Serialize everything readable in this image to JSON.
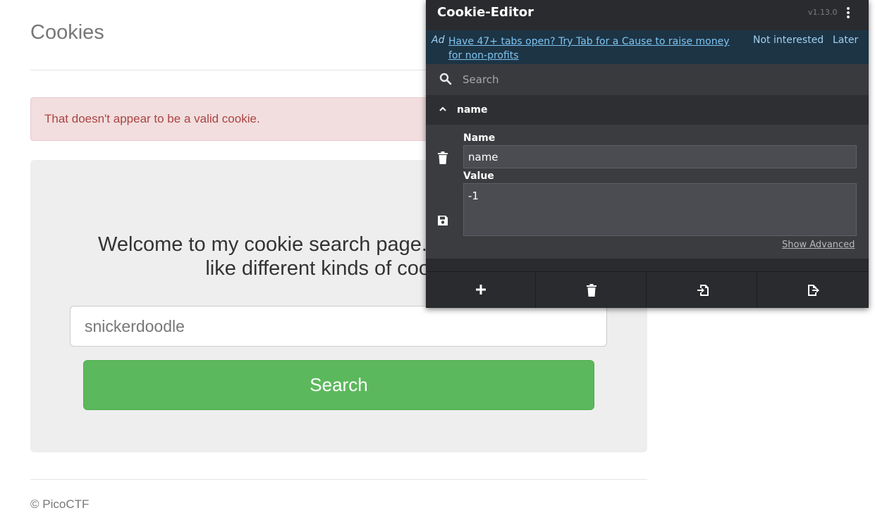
{
  "page": {
    "title": "Cookies",
    "alert": "That doesn't appear to be a valid cookie.",
    "welcome_line1": "Welcome to my cookie search page. See how much I",
    "welcome_line2": "like different kinds of cookies!",
    "search_placeholder": "snickerdoodle",
    "search_button": "Search",
    "footer": "© PicoCTF",
    "colors": {
      "button": "#5cb85c",
      "alert_text": "#a94442",
      "alert_bg": "#f2dede"
    }
  },
  "cookie_editor": {
    "title": "Cookie-Editor",
    "version": "v1.13.0",
    "ad": {
      "tag": "Ad",
      "text": "Have 47+ tabs open? Try Tab for a Cause to raise money for non-profits",
      "not_interested": "Not interested",
      "later": "Later"
    },
    "search_placeholder": "Search",
    "cookie": {
      "header_name": "name",
      "name_label": "Name",
      "name_value": "name",
      "value_label": "Value",
      "value_value": "-1",
      "show_advanced": "Show Advanced"
    },
    "footer_icons": [
      "plus-icon",
      "trash-icon",
      "import-icon",
      "export-icon"
    ]
  }
}
